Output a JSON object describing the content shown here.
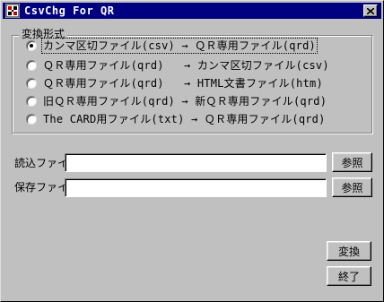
{
  "window": {
    "title": "CsvChg For QR"
  },
  "conversion": {
    "group_label": "変換形式",
    "options": [
      {
        "label": "カンマ区切ファイル(csv) → ＱＲ専用ファイル(qrd)",
        "checked": true
      },
      {
        "label": "ＱＲ専用ファイル(qrd)   → カンマ区切ファイル(csv)",
        "checked": false
      },
      {
        "label": "ＱＲ専用ファイル(qrd)   → HTML文書ファイル(htm)",
        "checked": false
      },
      {
        "label": "旧ＱＲ専用ファイル(qrd) → 新ＱＲ専用ファイル(qrd)",
        "checked": false
      },
      {
        "label": "The CARD用ファイル(txt) → ＱＲ専用ファイル(qrd)",
        "checked": false
      }
    ]
  },
  "files": {
    "input_label": "読込ファイル",
    "input_value": "",
    "output_label": "保存ファイル",
    "output_value": "",
    "browse_label": "参照"
  },
  "actions": {
    "convert_label": "変換",
    "exit_label": "終了"
  }
}
